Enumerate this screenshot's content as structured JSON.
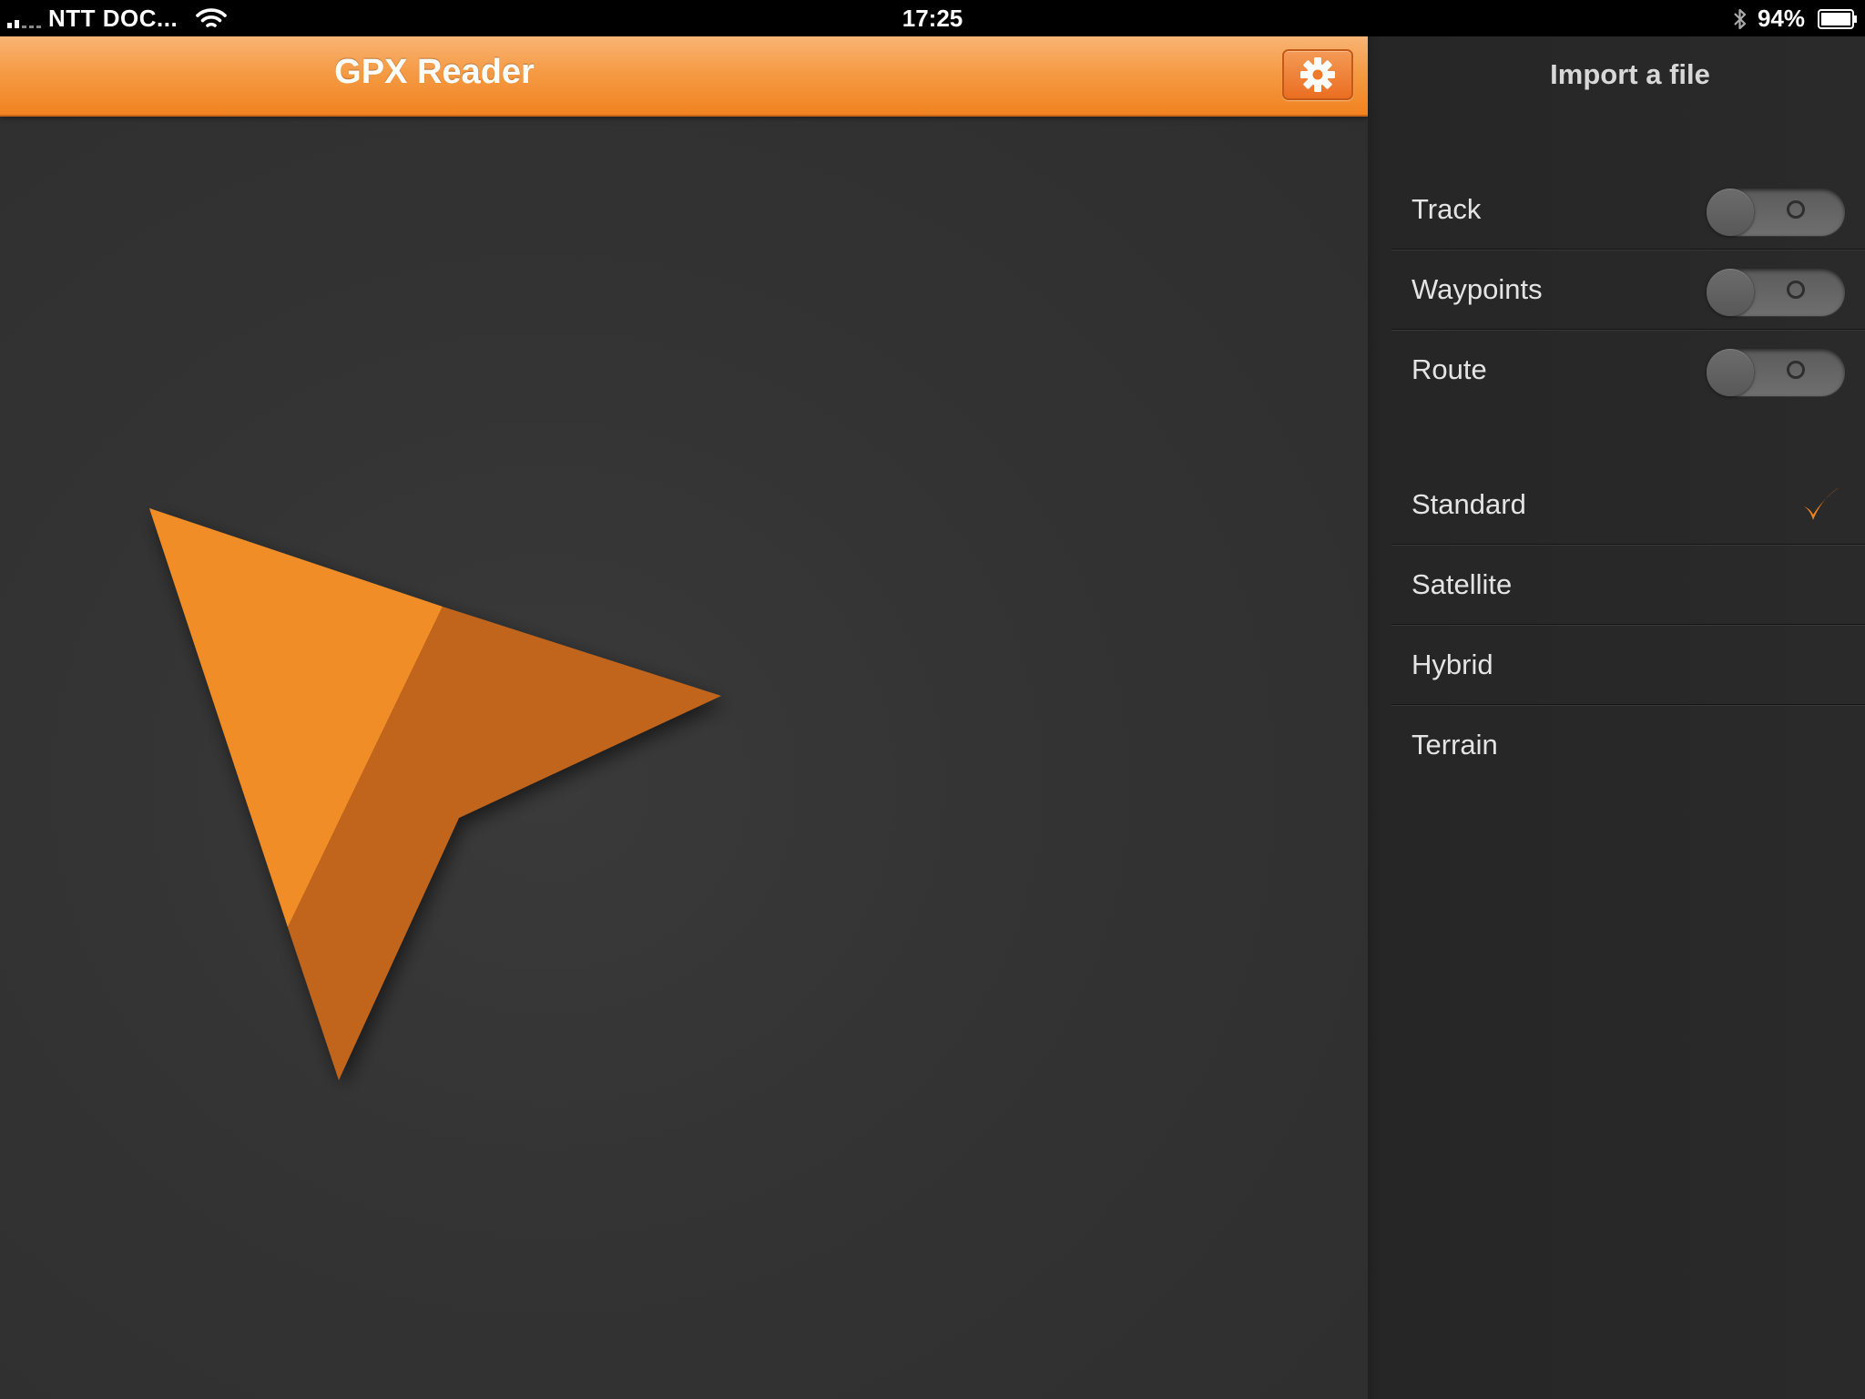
{
  "status_bar": {
    "carrier": "NTT DOC...",
    "time": "17:25",
    "battery": "94%",
    "icons": [
      "signal-icon",
      "wifi-icon",
      "bluetooth-icon",
      "battery-icon"
    ]
  },
  "main": {
    "title": "GPX Reader",
    "settings_icon": "gear-icon",
    "logo": "navigation-arrow-logo"
  },
  "side_panel": {
    "title": "Import a file",
    "import_options": [
      {
        "label": "Track",
        "on": false
      },
      {
        "label": "Waypoints",
        "on": false
      },
      {
        "label": "Route",
        "on": false
      }
    ],
    "map_types": [
      {
        "label": "Standard",
        "selected": true
      },
      {
        "label": "Satellite",
        "selected": false
      },
      {
        "label": "Hybrid",
        "selected": false
      },
      {
        "label": "Terrain",
        "selected": false
      }
    ]
  },
  "colors": {
    "accent": "#f0821f",
    "arrow_light": "#f08d26",
    "arrow_dark": "#c2651b",
    "background": "#313131",
    "panel": "#2a2a2a"
  }
}
